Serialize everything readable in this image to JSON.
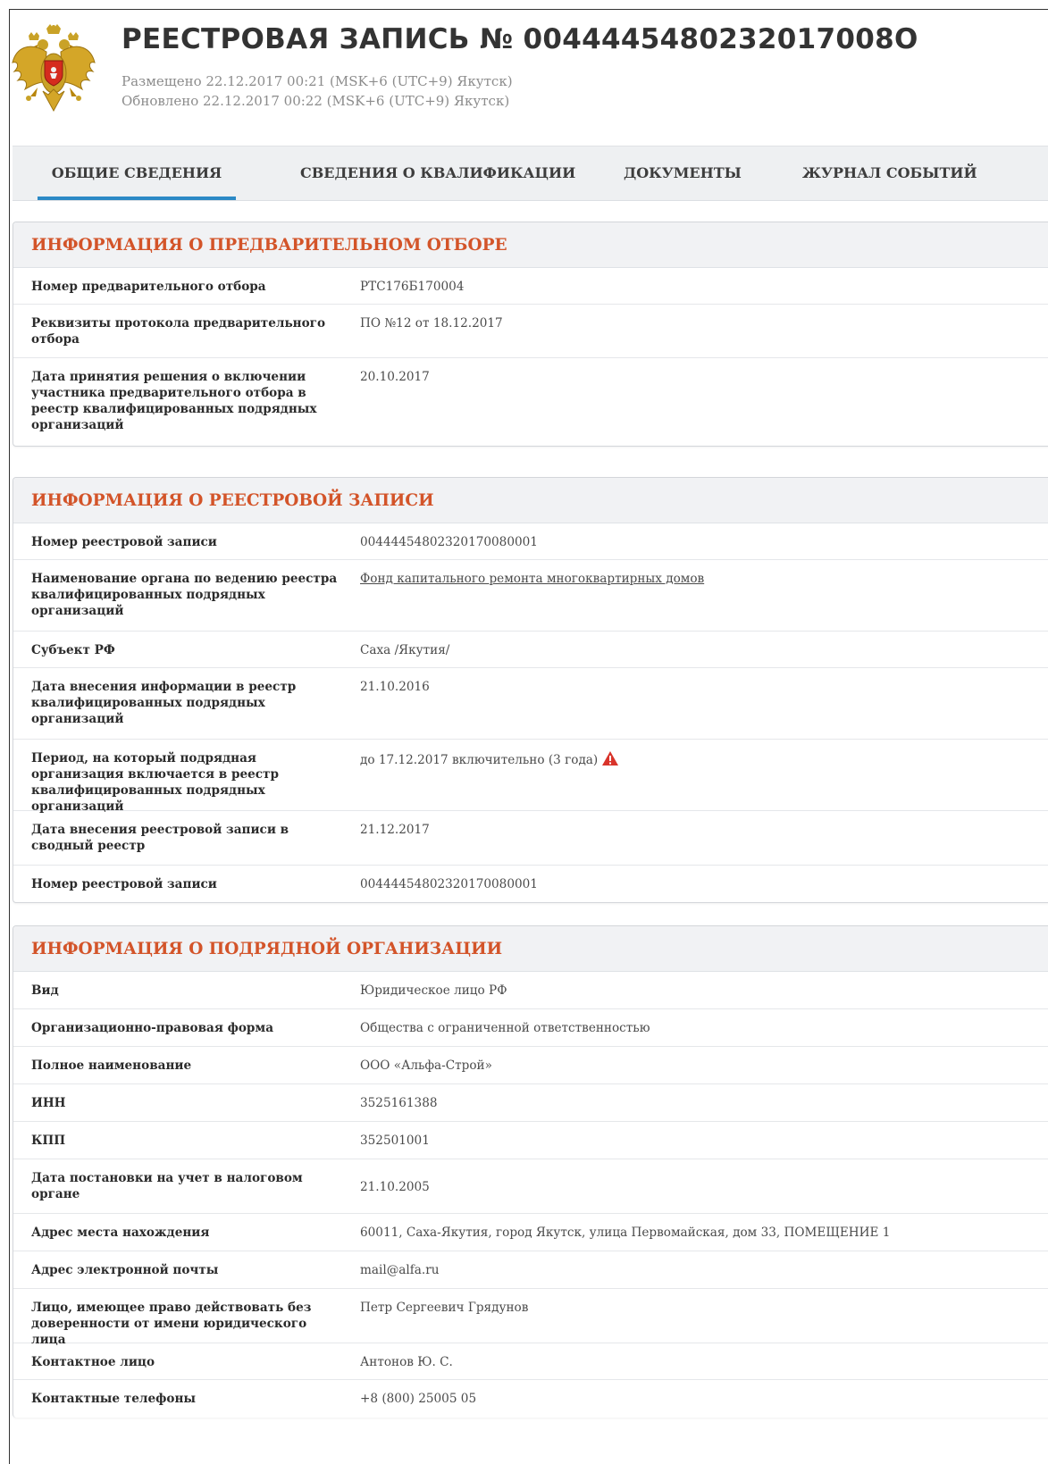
{
  "header": {
    "title": "РЕЕСТРОВАЯ ЗАПИСЬ № 0044445480232017008O",
    "posted": "Размещено 22.12.2017 00:21 (MSK+6 (UTC+9) Якутск)",
    "updated": "Обновлено 22.12.2017 00:22 (MSK+6 (UTC+9) Якутск)"
  },
  "tabs": [
    {
      "label": "ОБЩИЕ СВЕДЕНИЯ"
    },
    {
      "label": "СВЕДЕНИЯ О КВАЛИФИКАЦИИ"
    },
    {
      "label": "ДОКУМЕНТЫ"
    },
    {
      "label": "ЖУРНАЛ СОБЫТИЙ"
    }
  ],
  "sections": [
    {
      "title": "ИНФОРМАЦИЯ О ПРЕДВАРИТЕЛЬНОМ ОТБОРЕ",
      "rows": [
        {
          "label": "Номер предварительного отбора",
          "value": "РТС176Б170004"
        },
        {
          "label": "Реквизиты протокола предварительного отбора",
          "value": "ПО №12 от 18.12.2017"
        },
        {
          "label": "Дата принятия решения о включении участника предварительного отбора в реестр квалифицированных подрядных организаций",
          "value": "20.10.2017"
        }
      ]
    },
    {
      "title": "ИНФОРМАЦИЯ О РЕЕСТРОВОЙ ЗАПИСИ",
      "rows": [
        {
          "label": "Номер реестровой записи",
          "value": "00444454802320170080001"
        },
        {
          "label": "Наименование органа по ведению реестра квалифицированных подрядных организаций",
          "value": "Фонд капитального ремонта многоквартирных домов"
        },
        {
          "label": "Субъект РФ",
          "value": "Саха /Якутия/"
        },
        {
          "label": "Дата внесения информации в реестр квалифицированных подрядных организаций",
          "value": "21.10.2016"
        },
        {
          "label": "Период, на который подрядная организация включается в реестр квалифицированных подрядных организаций",
          "value": "до 17.12.2017 включительно (3 года)"
        },
        {
          "label": "Дата внесения реестровой записи в сводный реестр",
          "value": "21.12.2017"
        },
        {
          "label": "Номер реестровой записи",
          "value": "00444454802320170080001"
        }
      ]
    },
    {
      "title": "ИНФОРМАЦИЯ О ПОДРЯДНОЙ ОРГАНИЗАЦИИ",
      "rows": [
        {
          "label": "Вид",
          "value": "Юридическое лицо РФ"
        },
        {
          "label": "Организационно-правовая форма",
          "value": "Общества с ограниченной ответственностью"
        },
        {
          "label": "Полное наименование",
          "value": "ООО «Альфа-Строй»"
        },
        {
          "label": "ИНН",
          "value": "3525161388"
        },
        {
          "label": "КПП",
          "value": "352501001"
        },
        {
          "label": "Дата постановки на учет в налоговом органе",
          "value": "21.10.2005"
        },
        {
          "label": "Адрес места нахождения",
          "value": "60011, Саха-Якутия, город Якутск, улица Первомайская, дом 33, ПОМЕЩЕНИЕ 1"
        },
        {
          "label": "Адрес электронной почты",
          "value": "mail@alfa.ru"
        },
        {
          "label": "Лицо, имеющее право действовать без доверенности от имени юридического лица",
          "value": "Петр Сергеевич Грядунов"
        },
        {
          "label": "Контактное лицо",
          "value": "Антонов Ю. С."
        },
        {
          "label": "Контактные телефоны",
          "value": "+8 (800) 25005 05"
        }
      ]
    }
  ],
  "icons": {
    "emblem": "russian-coat-of-arms-icon",
    "warning": "warning-triangle-icon"
  },
  "colors": {
    "section_title": "#d35429",
    "link": "#1b7ac0",
    "tab_underline": "#2b89c6",
    "warning": "#d9342b"
  }
}
